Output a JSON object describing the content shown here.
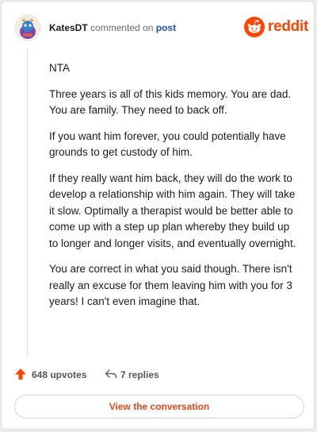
{
  "header": {
    "username": "KatesDT",
    "action_text": "commented on",
    "target_link": "post"
  },
  "brand": {
    "name": "reddit",
    "color": "#ff4500"
  },
  "comment": {
    "paragraphs": [
      "NTA",
      "Three years is all of this kids memory. You are dad. You are family. They need to back off.",
      "If you want him forever, you could potentially have grounds to get custody of him.",
      "If they really want him back, they will do the work to develop a relationship with him again. They will take it slow. Optimally a therapist would be better able to come up with a step up plan whereby they build up to longer and longer visits, and eventually overnight.",
      "You are correct in what you said though. There isn't really an excuse for them leaving him with you for 3 years! I can't even imagine that."
    ]
  },
  "actions": {
    "upvotes_label": "648 upvotes",
    "replies_label": "7 replies"
  },
  "cta": {
    "label": "View the conversation"
  },
  "icons": {
    "avatar": "user-avatar",
    "brand": "reddit-snoo-icon",
    "upvote": "upvote-arrow-icon",
    "reply": "reply-arrow-icon"
  },
  "colors": {
    "accent": "#ff4500",
    "link": "#1f4fb0",
    "cta_text": "#e8461b"
  }
}
